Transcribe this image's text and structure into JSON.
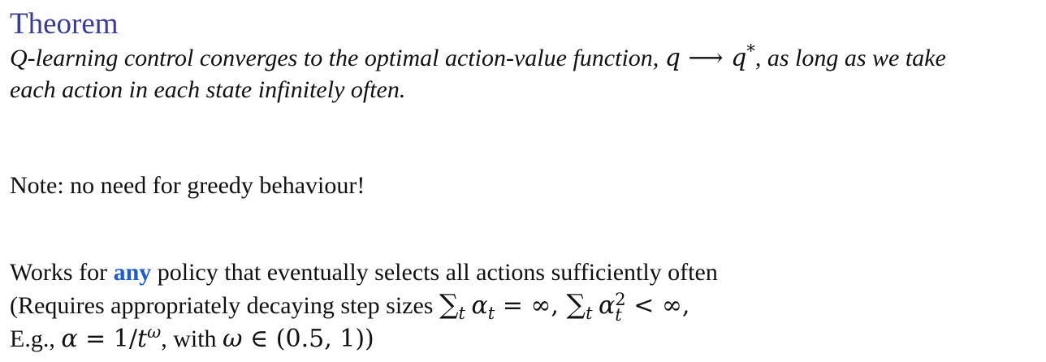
{
  "theorem": {
    "title": "Theorem",
    "line1_text": "Q-learning control converges to the optimal action-value function, ",
    "line1_math_q": "q",
    "line1_arrow": " ⟶ ",
    "line1_math_qstar": "q",
    "line1_star": "*",
    "line1_tail": ", as long as we take",
    "line2": "each action in each state infinitely often."
  },
  "note": {
    "text": "Note: no need for greedy behaviour!"
  },
  "works": {
    "line1_prefix": "Works for ",
    "line1_emphasis": "any",
    "line1_suffix": " policy that eventually selects all actions sufficiently often",
    "line2_prefix": "(Requires appropriately decaying step sizes ",
    "line2_sum1": "∑",
    "line2_sum1_sub": "t",
    "line2_alpha1": "α",
    "line2_alpha1_sub": "t",
    "line2_eq": " = ∞, ",
    "line2_sum2": "∑",
    "line2_sum2_sub": "t",
    "line2_alpha2": "α",
    "line2_alpha2_sup": "2",
    "line2_alpha2_sub": "t",
    "line2_lt": " < ∞,",
    "line3_prefix": "E.g., ",
    "line3_alpha": "α",
    "line3_eq": " = 1/",
    "line3_t": "t",
    "line3_omega_sup": "ω",
    "line3_with": ", with ",
    "line3_omega": "ω",
    "line3_in": " ∈ (0.5, 1))"
  }
}
